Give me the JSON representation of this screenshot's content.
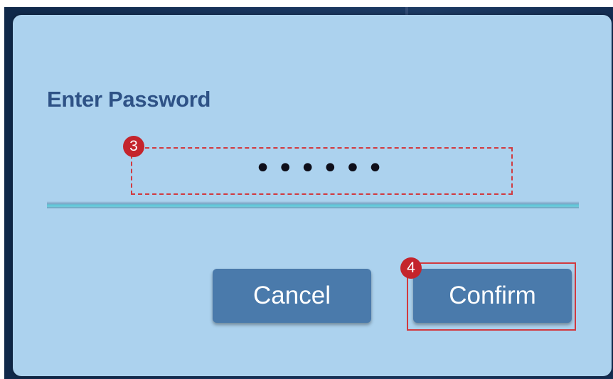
{
  "dialog": {
    "title": "Enter Password",
    "password_value": "••••••",
    "cancel_label": "Cancel",
    "confirm_label": "Confirm"
  },
  "annotations": {
    "step_password": "3",
    "step_confirm": "4",
    "highlight_color": "#d13a3f"
  },
  "colors": {
    "dialog_background": "#acd2ee",
    "title": "#2e5286",
    "button": "#4a7aab",
    "underline_accent": "#5bc6d6"
  }
}
